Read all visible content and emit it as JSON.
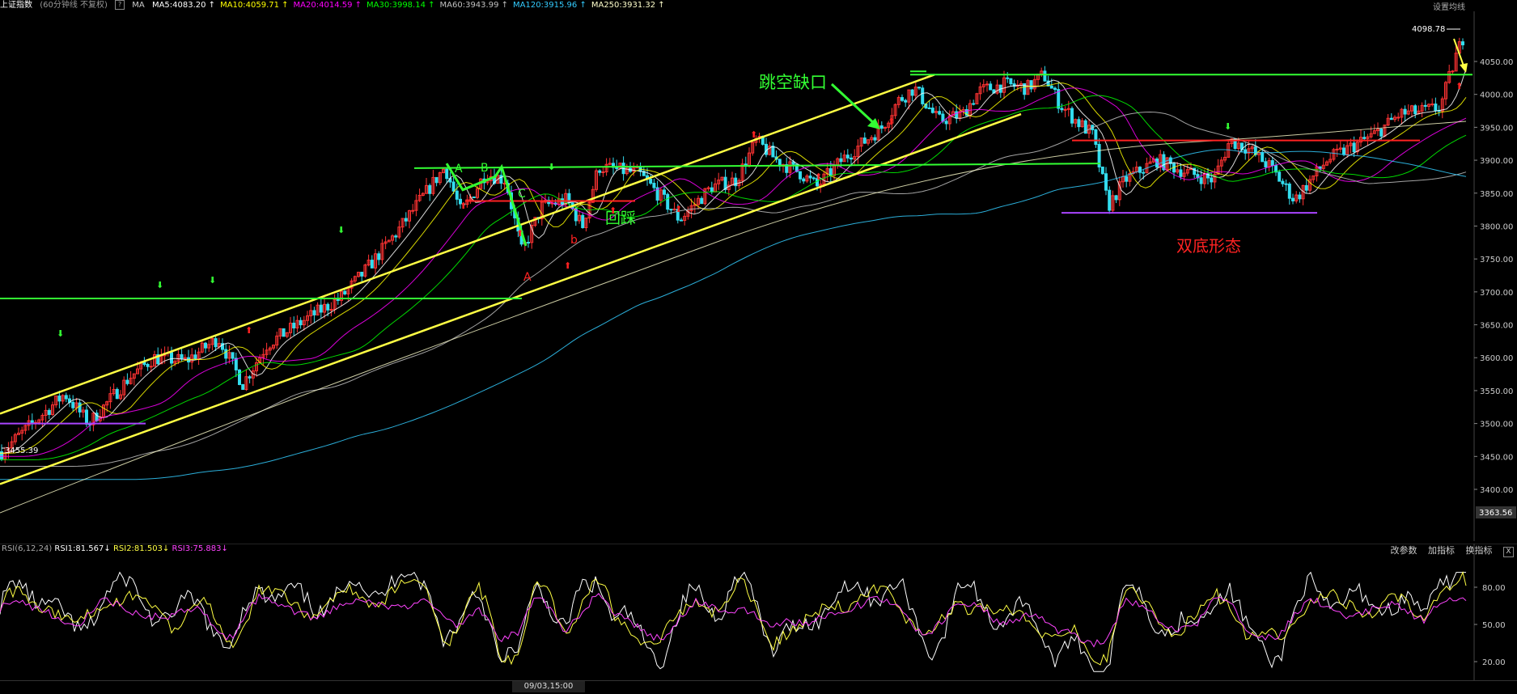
{
  "header": {
    "index_name": "上证指数",
    "period": "(60分钟线 不复权)",
    "help_icon": "?",
    "ma_label": "MA",
    "ma_values": [
      {
        "label": "MA5:4083.20",
        "color": "#ffffff"
      },
      {
        "label": "MA10:4059.71",
        "color": "#ffff00"
      },
      {
        "label": "MA20:4014.59",
        "color": "#ff00ff"
      },
      {
        "label": "MA30:3998.14",
        "color": "#00ff00"
      },
      {
        "label": "MA60:3943.99",
        "color": "#c0c0c0"
      },
      {
        "label": "MA120:3915.96",
        "color": "#33ccff"
      },
      {
        "label": "MA250:3931.32",
        "color": "#ffffcc"
      }
    ],
    "settings_label": "设置均线"
  },
  "price_axis": {
    "ticks": [
      "4050.00",
      "4000.00",
      "3950.00",
      "3900.00",
      "3850.00",
      "3800.00",
      "3750.00",
      "3700.00",
      "3650.00",
      "3600.00",
      "3550.00",
      "3500.00",
      "3450.00",
      "3400.00"
    ],
    "current_low_label": "3363.56",
    "high_label": "4098.78",
    "low_label": "3455.39"
  },
  "annotations": {
    "gap": "跳空缺口",
    "pullback": "回踩",
    "double_bottom": "双底形态",
    "point_A": "A",
    "point_B": "B",
    "point_C": "C",
    "point_A2": "A",
    "point_b": "b"
  },
  "rsi": {
    "label": "RSI(6,12,24)",
    "rsi1": "RSI1:81.567",
    "rsi2": "RSI2:81.503",
    "rsi3": "RSI3:75.883",
    "ticks": [
      "80.00",
      "50.00",
      "20.00"
    ],
    "tools": [
      "改参数",
      "加指标",
      "换指标"
    ],
    "close_icon": "X"
  },
  "time_axis": {
    "cursor_label": "09/03,15:00"
  },
  "colors": {
    "up": "#ff3333",
    "down": "#33ddee",
    "channel": "#ffff44",
    "support": "#33ff33",
    "resistance": "#ff2222",
    "neckline": "#aa44ff"
  }
}
